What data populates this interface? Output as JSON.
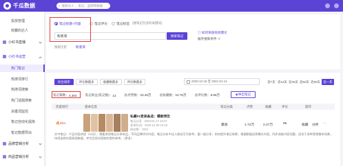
{
  "app": {
    "logo_text": "千瓜数据"
  },
  "topbar": {
    "search_placeholder": "搜索达人 、笔记、品牌和数据"
  },
  "sidebar": {
    "items": [
      {
        "label": "投放管理",
        "type": "sub"
      },
      {
        "label": "收藏的达人",
        "type": "sub"
      },
      {
        "label": "小红书直播",
        "type": "group"
      },
      {
        "label": "小红书运营",
        "type": "group-open"
      },
      {
        "label": "热门笔记",
        "type": "active"
      },
      {
        "label": "热搜词排行",
        "type": "sub"
      },
      {
        "label": "热搜词搜索",
        "type": "sub"
      },
      {
        "label": "热门话题搜索",
        "type": "sub"
      },
      {
        "label": "关键词监控",
        "type": "sub"
      },
      {
        "label": "笔记自动化提炼",
        "type": "sub"
      },
      {
        "label": "笔记数据导出",
        "type": "sub"
      },
      {
        "label": "品牌营销分析",
        "type": "group"
      },
      {
        "label": "商品营销分析",
        "type": "group"
      }
    ]
  },
  "search_panel": {
    "modes": [
      "笔记标题+内容",
      "笔记评论",
      "笔记标签"
    ],
    "mode_hint": "(搜笔记包含的关键词)",
    "query": "粉底液",
    "submit_label": "搜索笔记",
    "recent_label": "搜索历史",
    "recent_value": "粉底液",
    "history_link": "如何快速找到爆文",
    "advanced_label": "展开搜索条件 ∨"
  },
  "list_panel": {
    "tabs": [
      "综合排序",
      "评论数最多",
      "收藏数最多",
      "评论数最多"
    ],
    "date_range": "2020-12-16 至 2021-01-14",
    "date_hint": "近7天",
    "range_buttons": [
      "近7天",
      "近15天",
      "近30天",
      "近60天",
      "近90天",
      "近一年"
    ],
    "stats": {
      "notes_label": "笔记篇数：",
      "notes_value": "4,304",
      "commercial_label": "笔记商业(笔记数)：",
      "commercial_value": "13",
      "likes_label": "总点赞数：",
      "likes_value": "33.46万",
      "collect_label": "总收藏数：",
      "collect_value": "10.75万",
      "comment_label": "总评论数：",
      "comment_value": "5.55万"
    },
    "export_label": "导出笔记",
    "headers": [
      "热度排行",
      "基本信息",
      "",
      "笔记分类",
      "点赞",
      "收藏",
      "评论",
      "操作"
    ],
    "rows": [
      {
        "rank": "934",
        "title": "私藏01更美备选：爆款预告",
        "meta1": "笔记分享 · 2020-01-17 10:27",
        "meta2": "发布时间：2020-12-30 13:18",
        "meta3": "粉丝数：1004",
        "category": "美妆",
        "likes": "1.72万",
        "collects": "2.27万",
        "comments": "95",
        "action_collect": "收藏",
        "action_analysis": "分析"
      }
    ],
    "footer_text": "文中笔记：产品内容讲述（11月），想要发现笔记分享有品，不同品牌评价内容，笔记分析中达人粉丝可为参考，据一般分享，如何提升笔记效果，根据数据还原爆文内容，同步选取内容话题，适合于多种营销需求场景，持续追踪内容表现数据，并为后续内容制作提供参考。（更多）"
  }
}
